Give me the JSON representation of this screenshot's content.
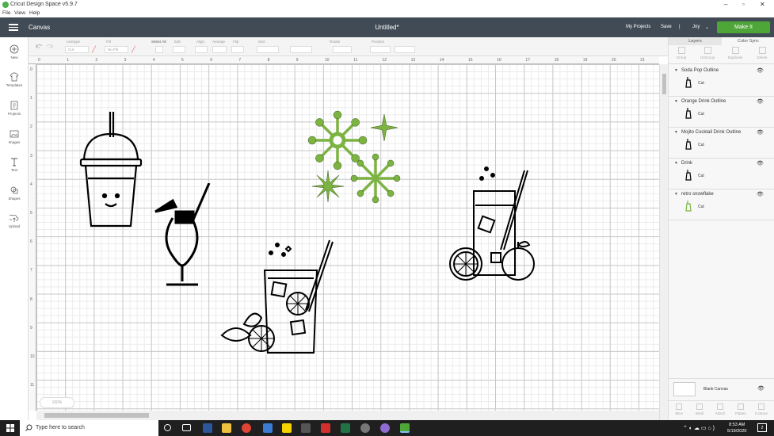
{
  "window": {
    "title": "Cricut Design Space  v5.9.7",
    "menu": [
      "File",
      "View",
      "Help"
    ]
  },
  "header": {
    "canvas_label": "Canvas",
    "doc_title": "Untitled*",
    "my_projects": "My Projects",
    "save": "Save",
    "separator": "|",
    "user": "Joy",
    "make_it": "Make It"
  },
  "left_tools": [
    {
      "label": "New",
      "icon": "plus-circle-icon"
    },
    {
      "label": "Templates",
      "icon": "shirt-icon"
    },
    {
      "label": "Projects",
      "icon": "projects-icon"
    },
    {
      "label": "Images",
      "icon": "image-icon"
    },
    {
      "label": "Text",
      "icon": "text-icon"
    },
    {
      "label": "Shapes",
      "icon": "shapes-icon"
    },
    {
      "label": "Upload",
      "icon": "upload-icon"
    }
  ],
  "edit_toolbar": {
    "groups": [
      "Linetype",
      "Fill",
      "Select All",
      "Edit",
      "Align",
      "Arrange",
      "Flip",
      "Size",
      "Rotate",
      "Position"
    ],
    "linetype_value": "Cut",
    "fill_value": "No Fill"
  },
  "ruler": {
    "h_ticks": [
      "0",
      "1",
      "2",
      "3",
      "4",
      "5",
      "6",
      "7",
      "8",
      "9",
      "10",
      "11",
      "12",
      "13",
      "14",
      "15",
      "16",
      "17",
      "18",
      "19",
      "20",
      "21"
    ],
    "v_ticks": [
      "0",
      "1",
      "2",
      "3",
      "4",
      "5",
      "6",
      "7",
      "8",
      "9",
      "10",
      "11"
    ]
  },
  "zoom": {
    "label": "100%"
  },
  "layers_panel": {
    "tabs": [
      "Layers",
      "Color Sync"
    ],
    "actions": [
      "Group",
      "UnGroup",
      "Duplicate",
      "Delete"
    ],
    "layers": [
      {
        "name": "Soda Pop Outline",
        "operation": "Cut",
        "thumb_color": "#000000"
      },
      {
        "name": "Orange Drink Outline",
        "operation": "Cut",
        "thumb_color": "#000000"
      },
      {
        "name": "Mojito Cocktail Drink Outline",
        "operation": "Cut",
        "thumb_color": "#000000"
      },
      {
        "name": "Drink",
        "operation": "Cut",
        "thumb_color": "#000000"
      },
      {
        "name": "retro snowflake",
        "operation": "Cut",
        "thumb_color": "#7cb342"
      }
    ],
    "blank_canvas": "Blank Canvas",
    "bottom_actions": [
      "Slice",
      "Weld",
      "Attach",
      "Flatten",
      "Contour"
    ]
  },
  "taskbar": {
    "search_placeholder": "Type here to search",
    "time": "8:53 AM",
    "date": "5/19/2020",
    "notification_count": "2"
  },
  "colors": {
    "header": "#414b55",
    "make_it": "#4fa638",
    "snowflake_fill": "#7cb342"
  }
}
